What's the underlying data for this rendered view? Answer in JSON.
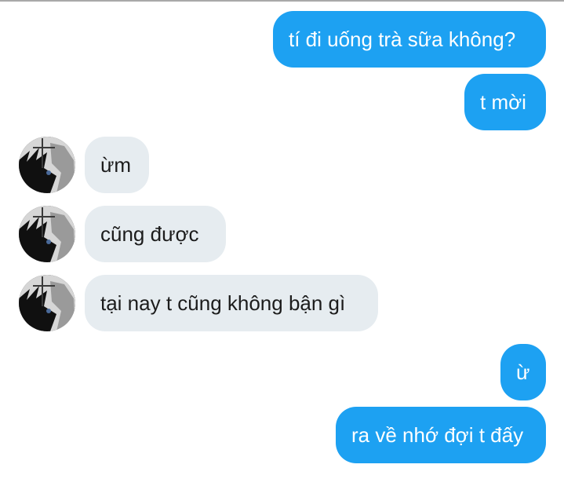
{
  "messages": [
    {
      "side": "sent",
      "text": "tí đi uống trà sữa không?"
    },
    {
      "side": "sent",
      "text": "t mời"
    },
    {
      "side": "received",
      "text": "ừm"
    },
    {
      "side": "received",
      "text": "cũng được"
    },
    {
      "side": "received",
      "text": "tại nay t cũng không bận gì"
    },
    {
      "side": "sent",
      "text": "ừ"
    },
    {
      "side": "sent",
      "text": "ra về nhớ đợi t đấy"
    }
  ],
  "colors": {
    "sent_bubble": "#1da1f2",
    "received_bubble": "#e6ecf0"
  },
  "avatar_icon": "contact-avatar"
}
